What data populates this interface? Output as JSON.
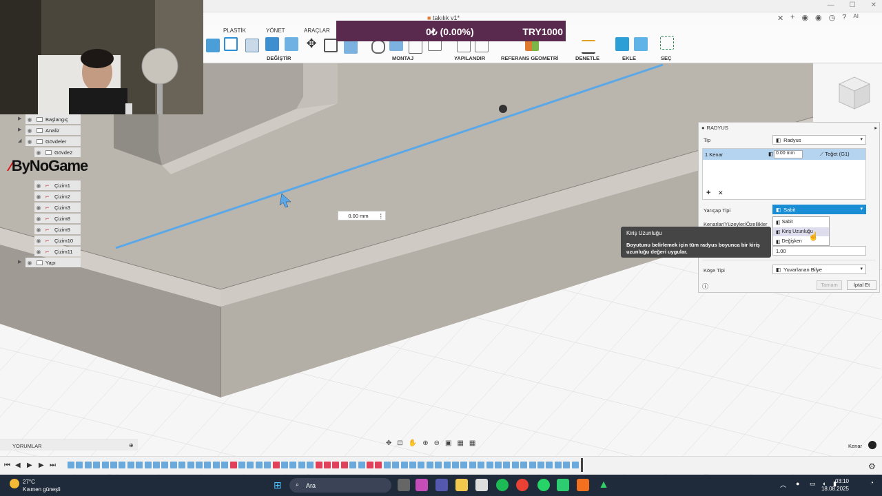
{
  "window": {
    "doc_title": "takılık v1*",
    "user_initials": "AI"
  },
  "toolbar": {
    "tabs": [
      "PLASTİK",
      "YÖNET",
      "ARAÇLAR"
    ],
    "groups": [
      "DEĞİŞTİR",
      "MONTAJ",
      "YAPILANDIR",
      "REFERANS GEOMETRİ",
      "DENETLE",
      "EKLE",
      "SEÇ"
    ]
  },
  "overlay": {
    "price_change": "0₺ (0.00%)",
    "price_target": "TRY1000",
    "logo_text": "ByNoGame"
  },
  "browser": {
    "items": [
      {
        "label": "Başlangıç",
        "kind": "folder"
      },
      {
        "label": "Analiz",
        "kind": "folder"
      },
      {
        "label": "Gövdeler",
        "kind": "folder"
      },
      {
        "label": "Gövde2",
        "kind": "body"
      },
      {
        "label": "Çizim1",
        "kind": "sketch"
      },
      {
        "label": "Çizim2",
        "kind": "sketch"
      },
      {
        "label": "Çizim3",
        "kind": "sketch"
      },
      {
        "label": "Çizim8",
        "kind": "sketch"
      },
      {
        "label": "Çizim9",
        "kind": "sketch"
      },
      {
        "label": "Çizim10",
        "kind": "sketch"
      },
      {
        "label": "Çizim11",
        "kind": "sketch"
      },
      {
        "label": "Yapı",
        "kind": "folder"
      }
    ]
  },
  "viewport": {
    "dim_value": "0.00 mm"
  },
  "dialog": {
    "title": "RADYUS",
    "type_label": "Tip",
    "type_value": "Radyus",
    "edge_count": "1 Kenar",
    "edge_value": "0.00 mm",
    "continuity": "Teğet (G1)",
    "radius_type_label": "Yarıçap Tipi",
    "radius_type_value": "Sabit",
    "options": [
      "Sabit",
      "Kiriş Uzunluğu",
      "Değişken"
    ],
    "hovered_option": "Kiriş Uzunluğu",
    "faces_label": "Kenarlar/Yüzeyler/Özellikler",
    "weight_value": "1.00",
    "corner_label": "Köşe Tipi",
    "corner_value": "Yuvarlanan Bilye",
    "ok_label": "Tamam",
    "cancel_label": "İptal Et"
  },
  "tooltip": {
    "title": "Kiriş Uzunluğu",
    "body": "Boyutunu belirlemek için tüm radyus boyunca bir kiriş uzunluğu değeri uygular."
  },
  "bottom": {
    "comments_label": "YORUMLAR",
    "selection_label": "Kenar"
  },
  "taskbar": {
    "temperature": "27°C",
    "weather": "Kısmen güneşli",
    "search_placeholder": "Ara",
    "time": "03:10",
    "date": "18.08.2025"
  },
  "colors": {
    "accent": "#0696d7",
    "overlay_bg": "#5a2a4e",
    "edge_highlight": "#5aa8e8",
    "model_top": "#bab5ad"
  }
}
